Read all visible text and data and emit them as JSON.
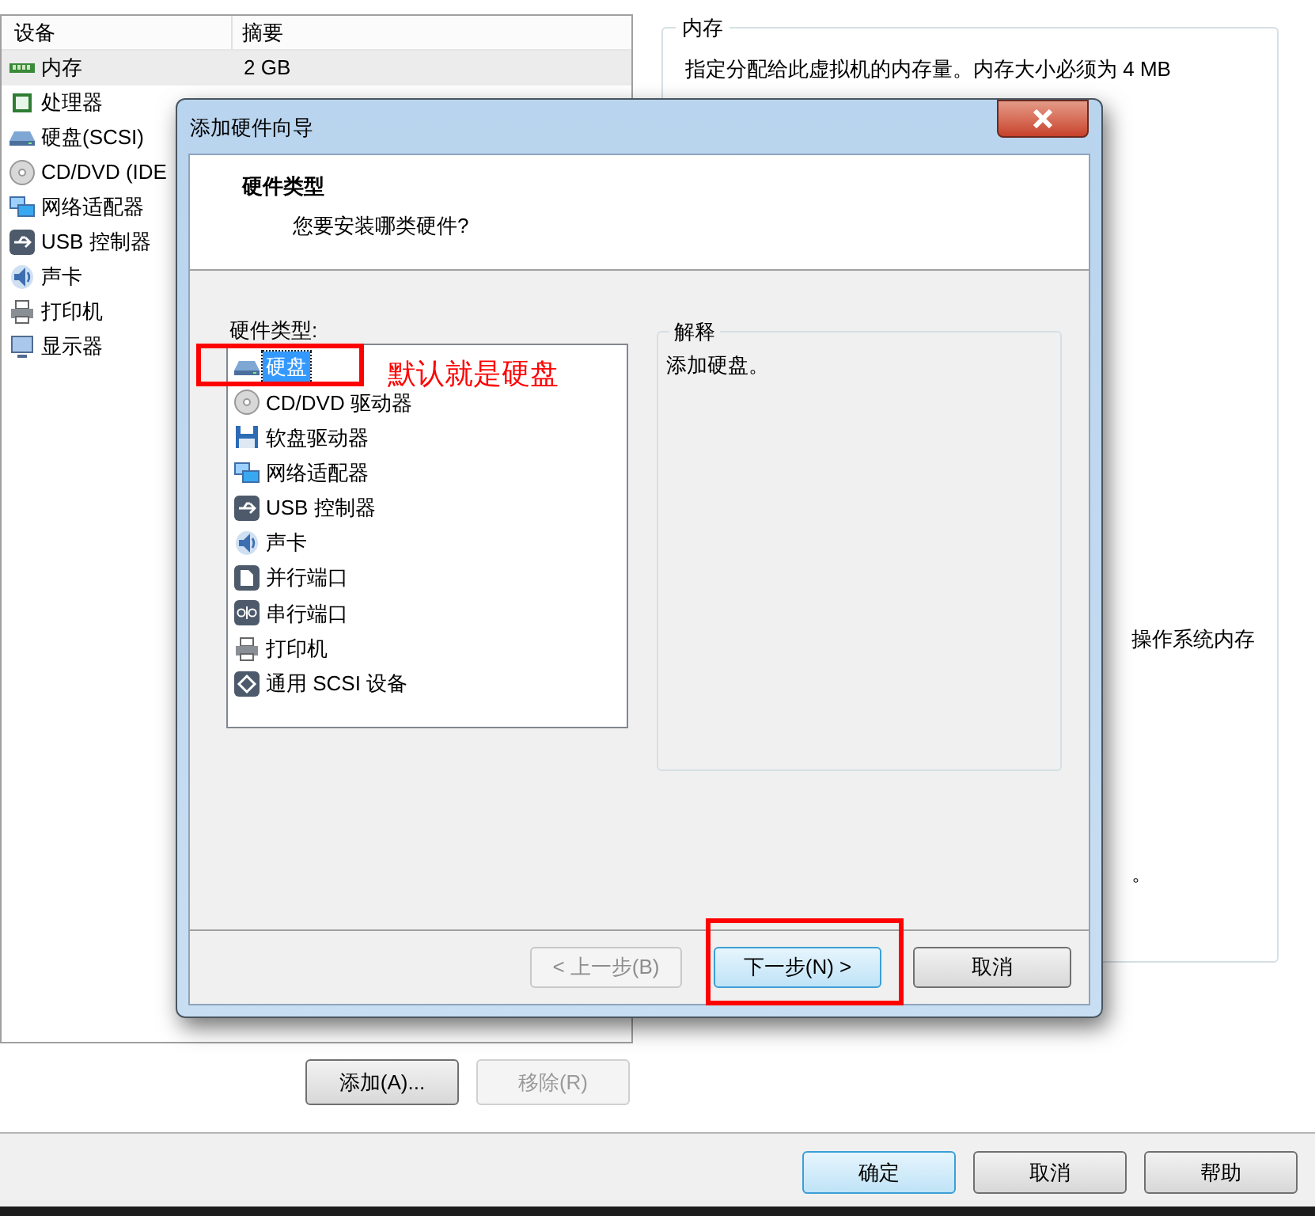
{
  "window": {
    "device_table": {
      "columns": [
        "设备",
        "摘要"
      ],
      "rows": [
        {
          "device": "内存",
          "summary": "2 GB",
          "kind": "memory",
          "selected": true
        },
        {
          "device": "处理器",
          "kind": "cpu",
          "selected": false
        },
        {
          "device": "硬盘(SCSI)",
          "kind": "disk",
          "selected": false
        },
        {
          "device": "CD/DVD (IDE",
          "kind": "cd",
          "selected": false
        },
        {
          "device": "网络适配器",
          "kind": "network",
          "selected": false
        },
        {
          "device": "USB 控制器",
          "kind": "usb",
          "selected": false
        },
        {
          "device": "声卡",
          "kind": "sound",
          "selected": false
        },
        {
          "device": "打印机",
          "kind": "printer",
          "selected": false
        },
        {
          "device": "显示器",
          "kind": "display",
          "selected": false
        }
      ]
    },
    "table_buttons": [
      {
        "label": "添加(A)...",
        "disabled": false
      },
      {
        "label": "移除(R)",
        "disabled": true
      }
    ],
    "memory_group": {
      "title": "内存",
      "description": "指定分配给此虚拟机的内存量。内存大小必须为 4 MB",
      "fragment_1": "操作系统内存",
      "fragment_2": "。"
    },
    "footer_buttons": [
      {
        "label": "确定",
        "default": true
      },
      {
        "label": "取消",
        "default": false
      },
      {
        "label": "帮助",
        "default": false
      }
    ]
  },
  "dialog": {
    "title": "添加硬件向导",
    "header_title": "硬件类型",
    "header_subtitle": "您要安装哪类硬件?",
    "list_label": "硬件类型:",
    "items": [
      {
        "label": "硬盘",
        "kind": "disk",
        "selected": true
      },
      {
        "label": "CD/DVD 驱动器",
        "kind": "cd",
        "selected": false
      },
      {
        "label": "软盘驱动器",
        "kind": "floppy",
        "selected": false
      },
      {
        "label": "网络适配器",
        "kind": "network",
        "selected": false
      },
      {
        "label": "USB 控制器",
        "kind": "usb",
        "selected": false
      },
      {
        "label": "声卡",
        "kind": "sound",
        "selected": false
      },
      {
        "label": "并行端口",
        "kind": "parallel",
        "selected": false
      },
      {
        "label": "串行端口",
        "kind": "serial",
        "selected": false
      },
      {
        "label": "打印机",
        "kind": "printer",
        "selected": false
      },
      {
        "label": "通用 SCSI 设备",
        "kind": "scsi",
        "selected": false
      }
    ],
    "explain_title": "解释",
    "explain_text": "添加硬盘。",
    "buttons": [
      {
        "label": "< 上一步(B)",
        "disabled": true,
        "highlighted": false
      },
      {
        "label": "下一步(N) >",
        "disabled": false,
        "highlighted": true
      },
      {
        "label": "取消",
        "disabled": false,
        "highlighted": false
      }
    ]
  },
  "annotation": {
    "text": "默认就是硬盘"
  }
}
